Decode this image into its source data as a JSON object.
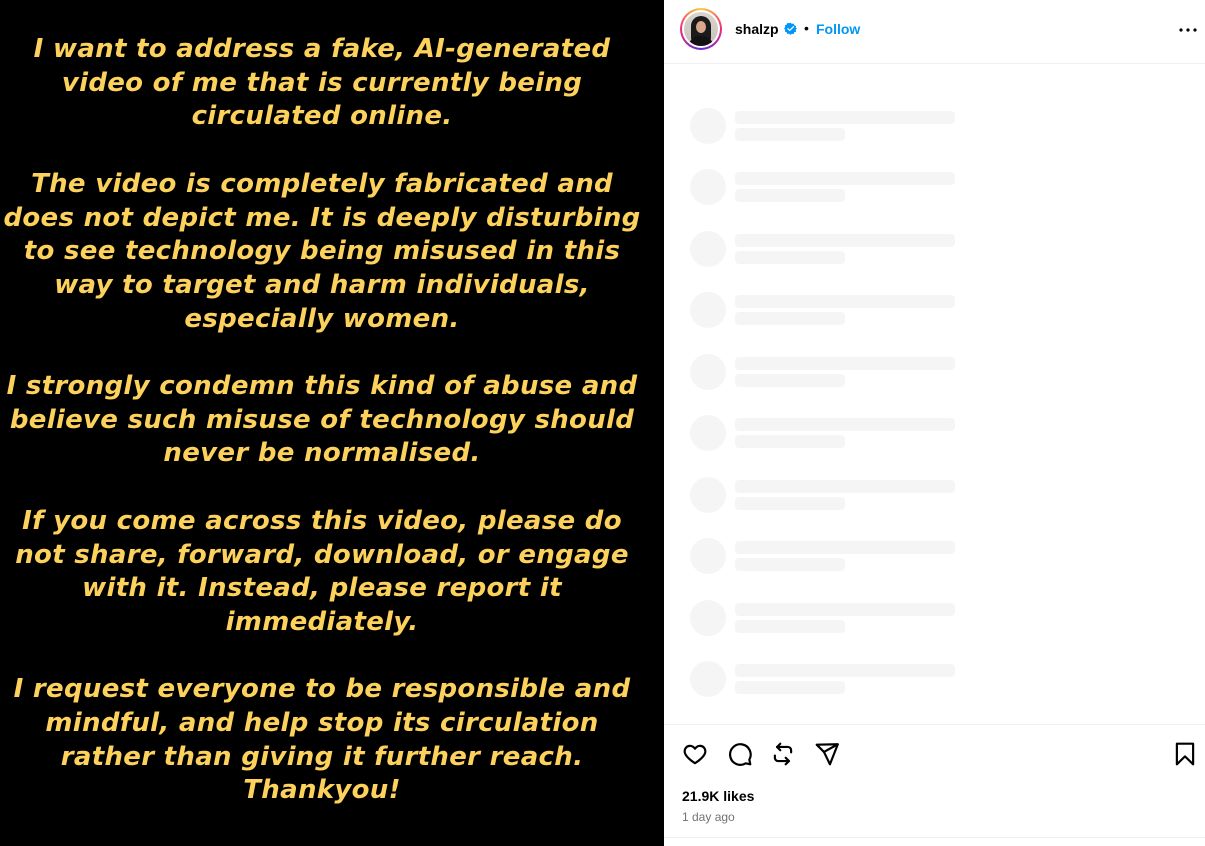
{
  "post": {
    "image_text": [
      "I want to address a fake, AI-generated video of me that is currently being circulated online.",
      "The video is completely fabricated and does not depict me. It is deeply disturbing to see technology being misused in this way to target and harm individuals, especially women.",
      "I strongly condemn this kind of abuse and believe such misuse of technology should never be normalised.",
      "If you come across this video, please do not share, forward, download, or engage with it. Instead, please report it immediately.",
      "I request everyone to be responsible and mindful, and help stop its circulation rather than giving it further reach.",
      "Thankyou!"
    ],
    "text_color": "#FCD15C",
    "background_color": "#000000"
  },
  "header": {
    "username": "shalzp",
    "verified": true,
    "separator": "•",
    "follow_label": "Follow",
    "more_icon": "more-horizontal-icon"
  },
  "comments": {
    "state": "loading",
    "skeleton_count": 10
  },
  "actions": {
    "icons": [
      "heart-icon",
      "comment-icon",
      "repost-icon",
      "share-icon",
      "bookmark-icon"
    ]
  },
  "stats": {
    "likes": "21.9K likes",
    "time": "1 day ago"
  },
  "colors": {
    "accent": "#0095F6",
    "verified": "#0095F6",
    "muted": "#737373",
    "skeleton": "#f5f5f5"
  }
}
